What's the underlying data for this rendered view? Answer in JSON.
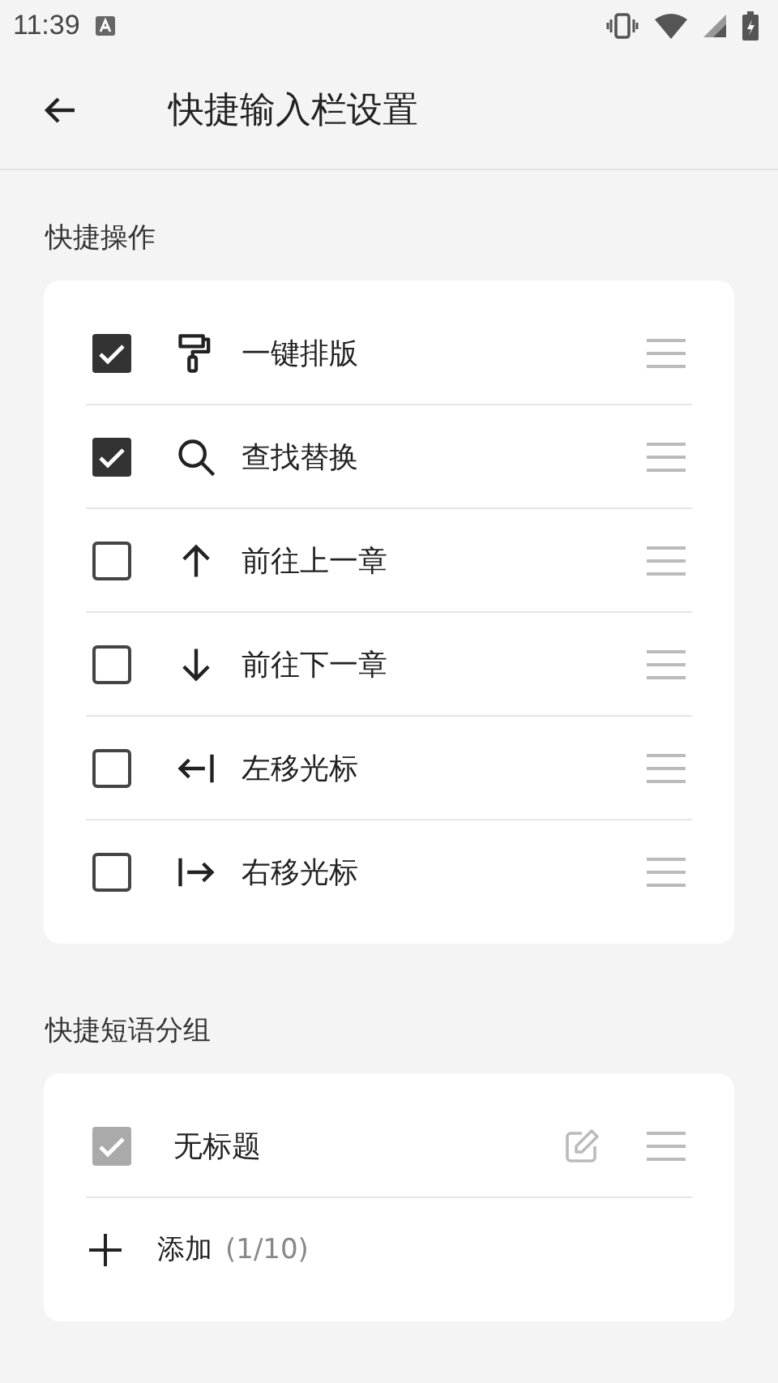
{
  "status_bar": {
    "time": "11:39"
  },
  "app_bar": {
    "title": "快捷输入栏设置"
  },
  "sections": [
    {
      "title": "快捷操作",
      "kind": "actions",
      "items": [
        {
          "kind": "roller",
          "label": "一键排版",
          "checked": true
        },
        {
          "kind": "search",
          "label": "查找替换",
          "checked": true
        },
        {
          "kind": "up",
          "label": "前往上一章",
          "checked": false
        },
        {
          "kind": "down",
          "label": "前往下一章",
          "checked": false
        },
        {
          "kind": "cursor-left",
          "label": "左移光标",
          "checked": false
        },
        {
          "kind": "cursor-right",
          "label": "右移光标",
          "checked": false
        }
      ]
    },
    {
      "title": "快捷短语分组",
      "kind": "groups",
      "items": [
        {
          "label": "无标题",
          "checked": true,
          "disabled": true
        }
      ],
      "add": {
        "label": "添加",
        "count": "(1/10)"
      }
    }
  ]
}
